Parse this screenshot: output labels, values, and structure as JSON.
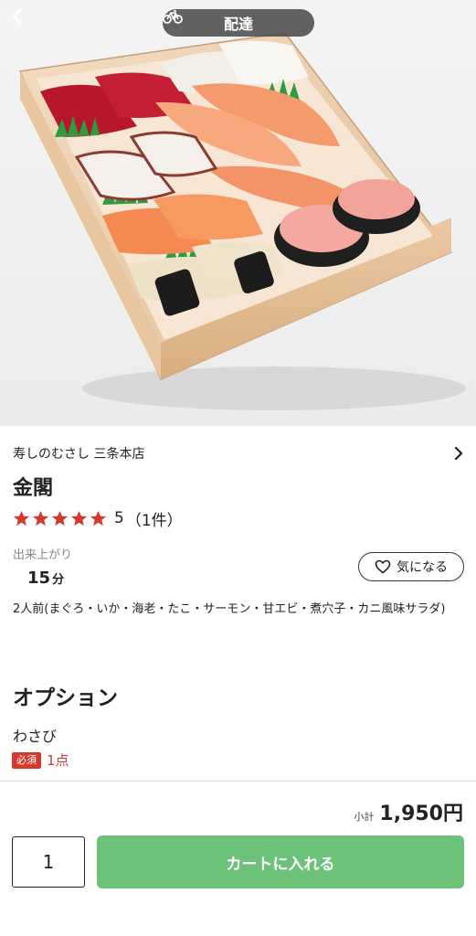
{
  "header": {
    "mode_label": "配達"
  },
  "product": {
    "shop_name": "寿しのむさし 三条本店",
    "name": "金閣",
    "rating_value": "5",
    "rating_count": "（1件）",
    "stars": 5,
    "ready_label": "出来上がり",
    "ready_minutes": "15",
    "ready_unit": "分",
    "favorite_label": "気になる",
    "description": "2人前(まぐろ・いか・海老・たこ・サーモン・甘エビ・煮穴子・カニ風味サラダ)"
  },
  "options": {
    "title": "オプション",
    "items": [
      {
        "name": "わさび",
        "required_label": "必須",
        "count_label": "1点"
      }
    ]
  },
  "footer": {
    "subtotal_label": "小計",
    "subtotal_value": "1,950円",
    "quantity": "1",
    "add_to_cart_label": "カートに入れる"
  },
  "colors": {
    "accent_green": "#6cc279",
    "star_red": "#d23a2b",
    "required_red": "#d23a2b"
  },
  "icons": {
    "back": "chevron-left-icon",
    "delivery": "bicycle-icon",
    "shop_link": "chevron-right-icon",
    "favorite": "heart-outline-icon",
    "star": "star-icon"
  }
}
